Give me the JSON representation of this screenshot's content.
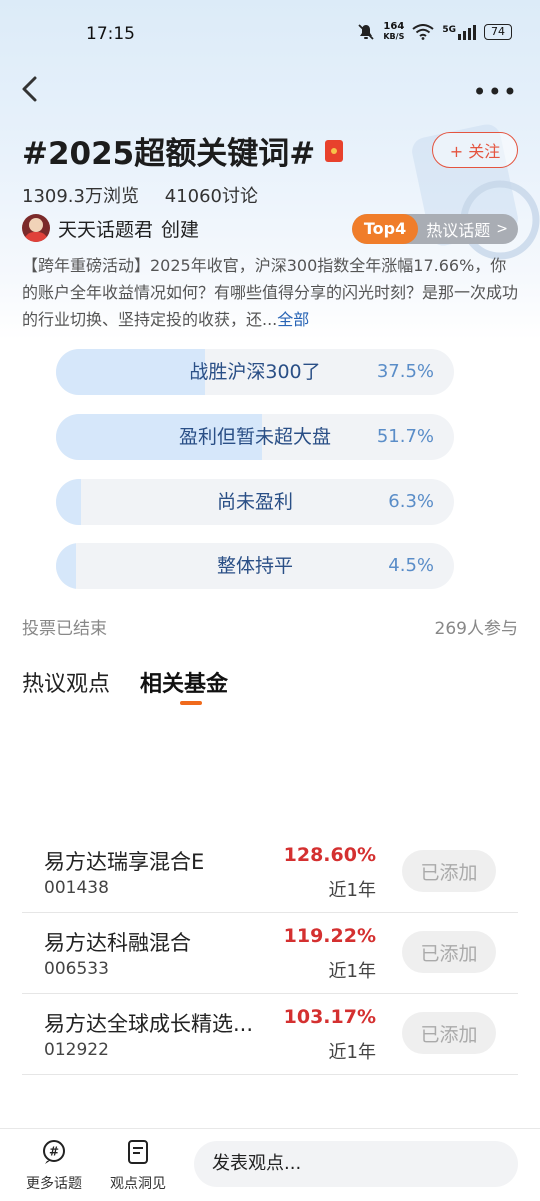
{
  "status_bar": {
    "time": "17:15",
    "net_speed": "164",
    "net_unit": "KB/S",
    "network": "5G",
    "battery": "74"
  },
  "topic": {
    "title": "#2025超额关键词#",
    "follow_label": "+ 关注",
    "views": "1309.3万浏览",
    "discussions": "41060讨论",
    "creator_name": "天天话题君",
    "creator_suffix": "创建",
    "rank_badge": "Top4",
    "rank_label": "热议话题",
    "description": "【跨年重磅活动】2025年收官，沪深300指数全年涨幅17.66%，你的账户全年收益情况如何？有哪些值得分享的闪光时刻？是那一次成功的行业切换、坚持定投的收获，还...",
    "more_label": "全部"
  },
  "vote": {
    "options": [
      {
        "label": "战胜沪深300了",
        "percent_text": "37.5%",
        "percent": 37.5
      },
      {
        "label": "盈利但暂未超大盘",
        "percent_text": "51.7%",
        "percent": 51.7
      },
      {
        "label": "尚未盈利",
        "percent_text": "6.3%",
        "percent": 6.3
      },
      {
        "label": "整体持平",
        "percent_text": "4.5%",
        "percent": 4.5
      }
    ],
    "status": "投票已结束",
    "participants": "269人参与"
  },
  "tabs": [
    {
      "label": "热议观点",
      "active": false
    },
    {
      "label": "相关基金",
      "active": true
    }
  ],
  "funds": [
    {
      "name": "易方达瑞享混合E",
      "code": "001438",
      "return": "128.60%",
      "period": "近1年",
      "button": "已添加"
    },
    {
      "name": "易方达科融混合",
      "code": "006533",
      "return": "119.22%",
      "period": "近1年",
      "button": "已添加"
    },
    {
      "name": "易方达全球成长精选...",
      "code": "012922",
      "return": "103.17%",
      "period": "近1年",
      "button": "已添加"
    }
  ],
  "bottom_bar": {
    "more_topics": "更多话题",
    "insights": "观点洞见",
    "post_placeholder": "发表观点..."
  },
  "colors": {
    "accent_orange": "#f06a1c",
    "follow_red": "#e4543f",
    "return_red": "#d43030",
    "vote_fill": "#d6e7fa"
  }
}
